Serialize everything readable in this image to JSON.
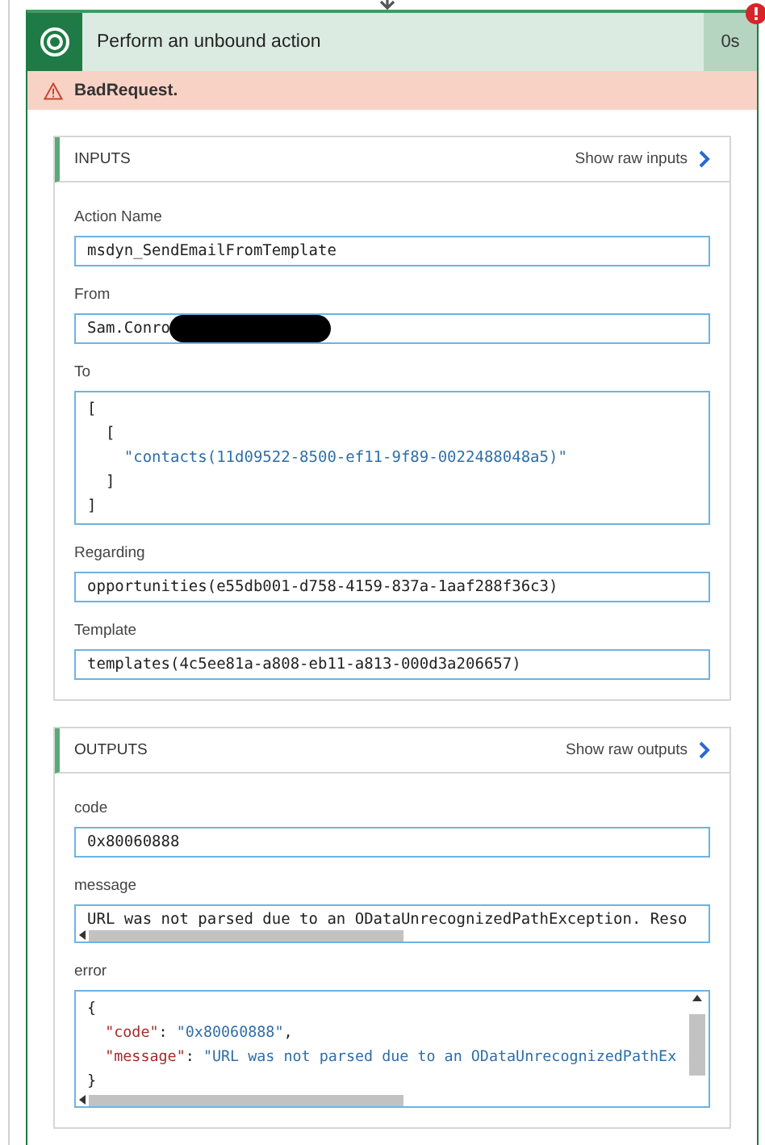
{
  "action": {
    "title": "Perform an unbound action",
    "duration": "0s",
    "failed": true,
    "error": "BadRequest."
  },
  "sections": [
    {
      "title": "INPUTS",
      "link": "Show raw inputs",
      "fields": [
        {
          "label": "Action Name",
          "kind": "text",
          "value": "msdyn_SendEmailFromTemplate"
        },
        {
          "label": "From",
          "kind": "text",
          "value": "Sam.Conro",
          "redacted": true
        },
        {
          "label": "To",
          "kind": "code",
          "lines": [
            [
              {
                "t": "[",
                "kind": "punct"
              }
            ],
            [
              {
                "t": "  [",
                "kind": "punct"
              }
            ],
            [
              {
                "t": "    \"contacts(11d09522-8500-ef11-9f89-0022488048a5)\"",
                "kind": "string"
              }
            ],
            [
              {
                "t": "  ]",
                "kind": "punct"
              }
            ],
            [
              {
                "t": "]",
                "kind": "punct"
              }
            ]
          ]
        },
        {
          "label": "Regarding",
          "kind": "text",
          "value": "opportunities(e55db001-d758-4159-837a-1aaf288f36c3)"
        },
        {
          "label": "Template",
          "kind": "text",
          "value": "templates(4c5ee81a-a808-eb11-a813-000d3a206657)"
        }
      ]
    },
    {
      "title": "OUTPUTS",
      "link": "Show raw outputs",
      "fields": [
        {
          "label": "code",
          "kind": "text",
          "value": "0x80060888"
        },
        {
          "label": "message",
          "kind": "scrolled-text",
          "value": "URL was not parsed due to an ODataUnrecognizedPathException. Reso"
        },
        {
          "label": "error",
          "kind": "scrolled-code",
          "lines": [
            [
              {
                "t": "{",
                "kind": "punct"
              }
            ],
            [
              {
                "t": "  \"code\"",
                "kind": "key"
              },
              {
                "t": ": ",
                "kind": "punct"
              },
              {
                "t": "\"0x80060888\"",
                "kind": "string"
              },
              {
                "t": ",",
                "kind": "punct"
              }
            ],
            [
              {
                "t": "  \"message\"",
                "kind": "key"
              },
              {
                "t": ": ",
                "kind": "punct"
              },
              {
                "t": "\"URL was not parsed due to an ODataUnrecognizedPathEx",
                "kind": "string"
              }
            ],
            [
              {
                "t": "}",
                "kind": "punct"
              }
            ]
          ]
        }
      ]
    }
  ]
}
